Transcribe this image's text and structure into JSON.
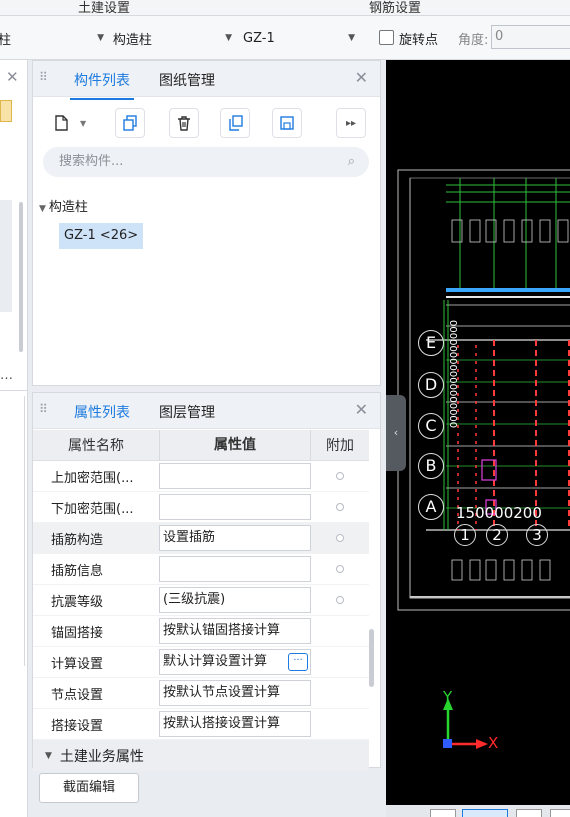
{
  "ribbon": {
    "civil_settings": "土建设置",
    "rebar_settings": "钢筋设置"
  },
  "selector": {
    "combo1_value": "柱",
    "combo2_value": "构造柱",
    "combo3_value": "GZ-1",
    "rotate_label": "旋转点",
    "angle_label": "角度:",
    "angle_value": "0"
  },
  "component_panel": {
    "tab_list": "构件列表",
    "tab_drawings": "图纸管理",
    "search_placeholder": "搜索构件...",
    "tree_root": "构造柱",
    "tree_item": "GZ-1 <26>"
  },
  "property_panel": {
    "tab_props": "属性列表",
    "tab_layers": "图层管理",
    "col_name": "属性名称",
    "col_value": "属性值",
    "col_extra": "附加",
    "rows": [
      {
        "name": "上加密范围(...",
        "value": ""
      },
      {
        "name": "下加密范围(...",
        "value": ""
      },
      {
        "name": "插筋构造",
        "value": "设置插筋"
      },
      {
        "name": "插筋信息",
        "value": ""
      },
      {
        "name": "抗震等级",
        "value": "(三级抗震)"
      },
      {
        "name": "锚固搭接",
        "value": "按默认锚固搭接计算"
      },
      {
        "name": "计算设置",
        "value": "默认计算设置计算"
      },
      {
        "name": "节点设置",
        "value": "按默认节点设置计算"
      },
      {
        "name": "搭接设置",
        "value": "按默认搭接设置计算"
      }
    ],
    "group_label": "土建业务属性",
    "section_edit": "截面编辑"
  },
  "canvas": {
    "axis_labels": [
      "E",
      "D",
      "C",
      "B",
      "A"
    ],
    "grid_numbers": [
      "1",
      "2",
      "3"
    ],
    "axis_x": "X",
    "axis_y": "Y"
  }
}
